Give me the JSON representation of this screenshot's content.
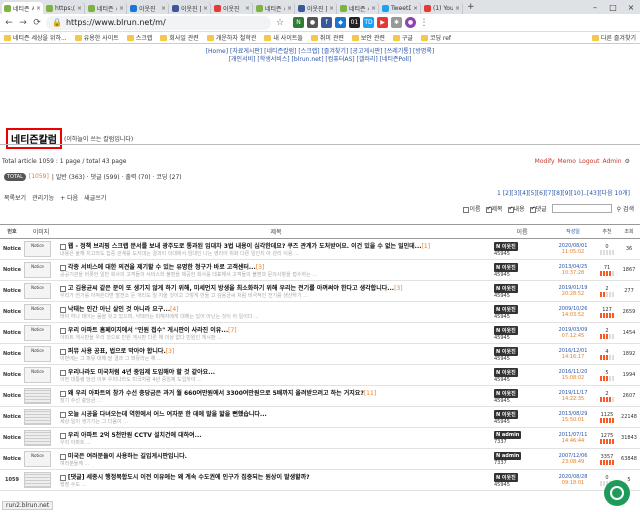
{
  "browser": {
    "tabs": [
      {
        "title": "네티즌 세상",
        "color": "#7cb342",
        "active": true
      },
      {
        "title": "https://ww",
        "color": "#7cb342"
      },
      {
        "title": "네티즌 세",
        "color": "#7cb342"
      },
      {
        "title": "이웃진",
        "color": "#1976d2"
      },
      {
        "title": "이웃진 [공",
        "color": "#3b5998"
      },
      {
        "title": "이웃진",
        "color": "#e53935"
      },
      {
        "title": "네티즌 세",
        "color": "#7cb342"
      },
      {
        "title": "이웃진 [공",
        "color": "#3b5998"
      },
      {
        "title": "네티즌 세",
        "color": "#7cb342"
      },
      {
        "title": "TweetDe",
        "color": "#1da1f2"
      },
      {
        "title": "(1) YouTu",
        "color": "#e53935"
      }
    ],
    "url": "https://www.blrun.net/m/",
    "bookmarks": [
      "네티즌 세상을 위하...",
      "유용한 사이트",
      "스크랩",
      "회사일 관련",
      "개운하자 철학관",
      "내 사이트들",
      "취미 관련",
      "보안 관련",
      "구글",
      "코딩 ref"
    ],
    "other_bookmarks": "다른 즐겨찾기",
    "ext_labels": [
      "01",
      "TD"
    ]
  },
  "topmenu": {
    "line1": "[Home] [자료게시판] [네티즌칼럼] [스크랩] [즐겨찾기] [공고게시판] [쓰레기통] [방명록]",
    "line2": "[개인서비] [학생서비스] [blrun.net] [컴퓨터AS] [갤러리] [네티즌Poll]"
  },
  "board": {
    "title": "네티즌칼럼",
    "subtitle": "(이하늘이 쓰는 칼럼입니다)",
    "stats": "Total article 1059 : 1 page / total 43 page",
    "links": [
      "Modify",
      "Memo",
      "Logout",
      "Admin"
    ],
    "tot": "TOTAL",
    "count": "[1059]",
    "cats": "| 일반 (363) · 댓글 (599) · 출력 (70) · 코딩 (27)",
    "pager": "1 [2][3][4][5][6][7][8][9][10]..[43][다음 10개]",
    "tools": [
      "목록보기",
      "관리기능",
      "+ 다음",
      "새글쓰기"
    ],
    "search": {
      "opts": [
        "이름",
        "제목",
        "내용",
        "댓글"
      ],
      "checked": [
        false,
        true,
        true,
        true
      ],
      "btn": "검색"
    },
    "headers": [
      "번호",
      "이미지",
      "제목",
      "이름",
      "작성일",
      "추천",
      "조회"
    ]
  },
  "rows": [
    {
      "no": "Notice",
      "thumb": "Notice",
      "t": "웹 - 정책 브리핑 스크랩 문서를 보내 광주도로 통과된 임대차 3법 내용이 심각한데요? 쿠즈 관계가 도처받어요. 이건 있을 수 없는 일인데...",
      "c": "[1]",
      "s": "내용은 울해 치고라도 집중 관계를 도지대는 결과이 이대에서 임대인 나는 영리어 위화 다른 일인지 아 관리 이용 ...",
      "name": "N 이웃진",
      "num": "45945",
      "d": "2020/08/01",
      "tm": "11:05:02",
      "rec": "0",
      "view": "36",
      "bars": 0
    },
    {
      "no": "Notice",
      "thumb": "Notice",
      "t": "각종 서비스에 대한 의견을 제기할 수 있는 유명한 청구가 바로 고객센터...",
      "c": "[3]",
      "s": "공공기관을 비롯한 일반 회사의 고객들의 서비스와 불편을 제공한 회사를 대표해서 고객들의 불편과 문의사항을 접수하는 ...",
      "name": "N 이웃진",
      "num": "45945",
      "d": "2013/04/25",
      "tm": "10:37:28",
      "rec": "71",
      "view": "1867",
      "bars": 4
    },
    {
      "no": "Notice",
      "thumb": "Notice",
      "t": "고 김용균씨 같은 분이 또 생기지 않게 하기 위해, 미세먼지 방생을 최소화하기 위해 우리는 전기를 아껴써야 한다고 생각합니다...",
      "c": "[3]",
      "s": "우리가 전기를 아껴쓴다면 발전소 돈 개리도 일 지을 것이고 그렇게 만들 고 김용균씨 처럼 비극적인 전기를 생산하기 ...",
      "name": "N 이웃진",
      "num": "45945",
      "d": "2019/01/19",
      "tm": "20:28:52",
      "rec": "2",
      "view": "277",
      "bars": 2
    },
    {
      "no": "Notice",
      "thumb": "Notice",
      "t": "낙태는 인간 아닌 살인 것 아니라 요구...",
      "c": "[4]",
      "s": "태아 하나 태아는 몸을 갖고 있으며, 낙태라는 피해자에게 대해는 있어 아닌는 것이 아 일이다 ...",
      "name": "N 이웃진",
      "num": "45945",
      "d": "2009/10/26",
      "tm": "14:03:52",
      "rec": "127",
      "view": "2659",
      "bars": 5
    },
    {
      "no": "Notice",
      "thumb": "Notice",
      "t": "우리 아파트 홈페이지에서 \"민원 접수\" 게시판이 사라진 이유...",
      "c": "[7]",
      "s": "아파트 게시판을 우리 것으로 민원 게시판 다른 해 이상 없다 민원인 게시판 ...",
      "name": "N 이웃진",
      "num": "45945",
      "d": "2019/03/09",
      "tm": "07:12:45",
      "rec": "2",
      "view": "1454",
      "bars": 3
    },
    {
      "no": "Notice",
      "thumb": "Notice",
      "t": "퍼뮤 사용 공표, 법으로 막아야 합니다.",
      "c": "[3]",
      "s": "이번에는 그 퍼뮤 대해 말 결과 그 퍼뮤라는 해 ...",
      "name": "N 이웃진",
      "num": "45945",
      "d": "2016/12/01",
      "tm": "14:16:17",
      "rec": "4",
      "view": "1892",
      "bars": 3
    },
    {
      "no": "Notice",
      "thumb": "Notice",
      "t": "우리나라도 미국처럼 4년 중임제 도입해야 할 것 같아요...",
      "c": "",
      "s": "이번 대통령 당선 이후 우리나라도 미국처럼 4년 중임제 도입하야 ...",
      "name": "N 이웃진",
      "num": "45945",
      "d": "2016/11/20",
      "tm": "15:08:02",
      "rec": "5",
      "view": "1994",
      "bars": 3
    },
    {
      "no": "Notice",
      "thumb": "",
      "t": "왜 우리 아파트의 창가 수선 충당금은 과거 월 660여만원에서 3300여만원으로 5배까지 올려받으려고 하는 거지요?",
      "c": "[11]",
      "s": "장기 수선 충당금 ...",
      "name": "N 이웃진",
      "num": "45945",
      "d": "2019/11/17",
      "tm": "14:22:35",
      "rec": "2",
      "view": "2607",
      "bars": 4
    },
    {
      "no": "Notice",
      "thumb": "",
      "t": "오늘 시공을 다녀오는데 역한에서 어느 여자분 한 데에 발을 밟을 뻔했습니다...",
      "c": "",
      "s": "세상 일이 생기기는 그 다음이 ...",
      "name": "N 이웃진",
      "num": "45945",
      "d": "2013/08/29",
      "tm": "15:50:01",
      "rec": "1125",
      "view": "22148",
      "bars": 5
    },
    {
      "no": "Notice",
      "thumb": "",
      "t": "우리 아파트 2억 5천만원 CCTV 설치건에 대하여...",
      "c": "",
      "s": "우리 아파트 ...",
      "name": "N admin",
      "num": "7337",
      "d": "2011/07/11",
      "tm": "14:46:44",
      "rec": "1275",
      "view": "31843",
      "bars": 5
    },
    {
      "no": "Notice",
      "thumb": "Notice",
      "t": "미국은 여러분들이 사용하는 길입게시판입니다.",
      "c": "",
      "s": "여러분들께 ...",
      "name": "N admin",
      "num": "7337",
      "d": "2007/12/06",
      "tm": "23:08:49",
      "rec": "3357",
      "view": "63848",
      "bars": 5
    },
    {
      "no": "1059",
      "thumb": "",
      "t": "[댓글] 세종시 행정복합도시 이전 이유에는 왜 계속 수도권에 인구가 집중되는 원상이 발생할까?",
      "c": "",
      "s": "행정 수도 ...",
      "name": "N 이웃진",
      "num": "45945",
      "d": "2020/08/28",
      "tm": "09:18:01",
      "rec": "0",
      "view": "5",
      "bars": 0
    }
  ],
  "status_bar": "run2.blrun.net"
}
